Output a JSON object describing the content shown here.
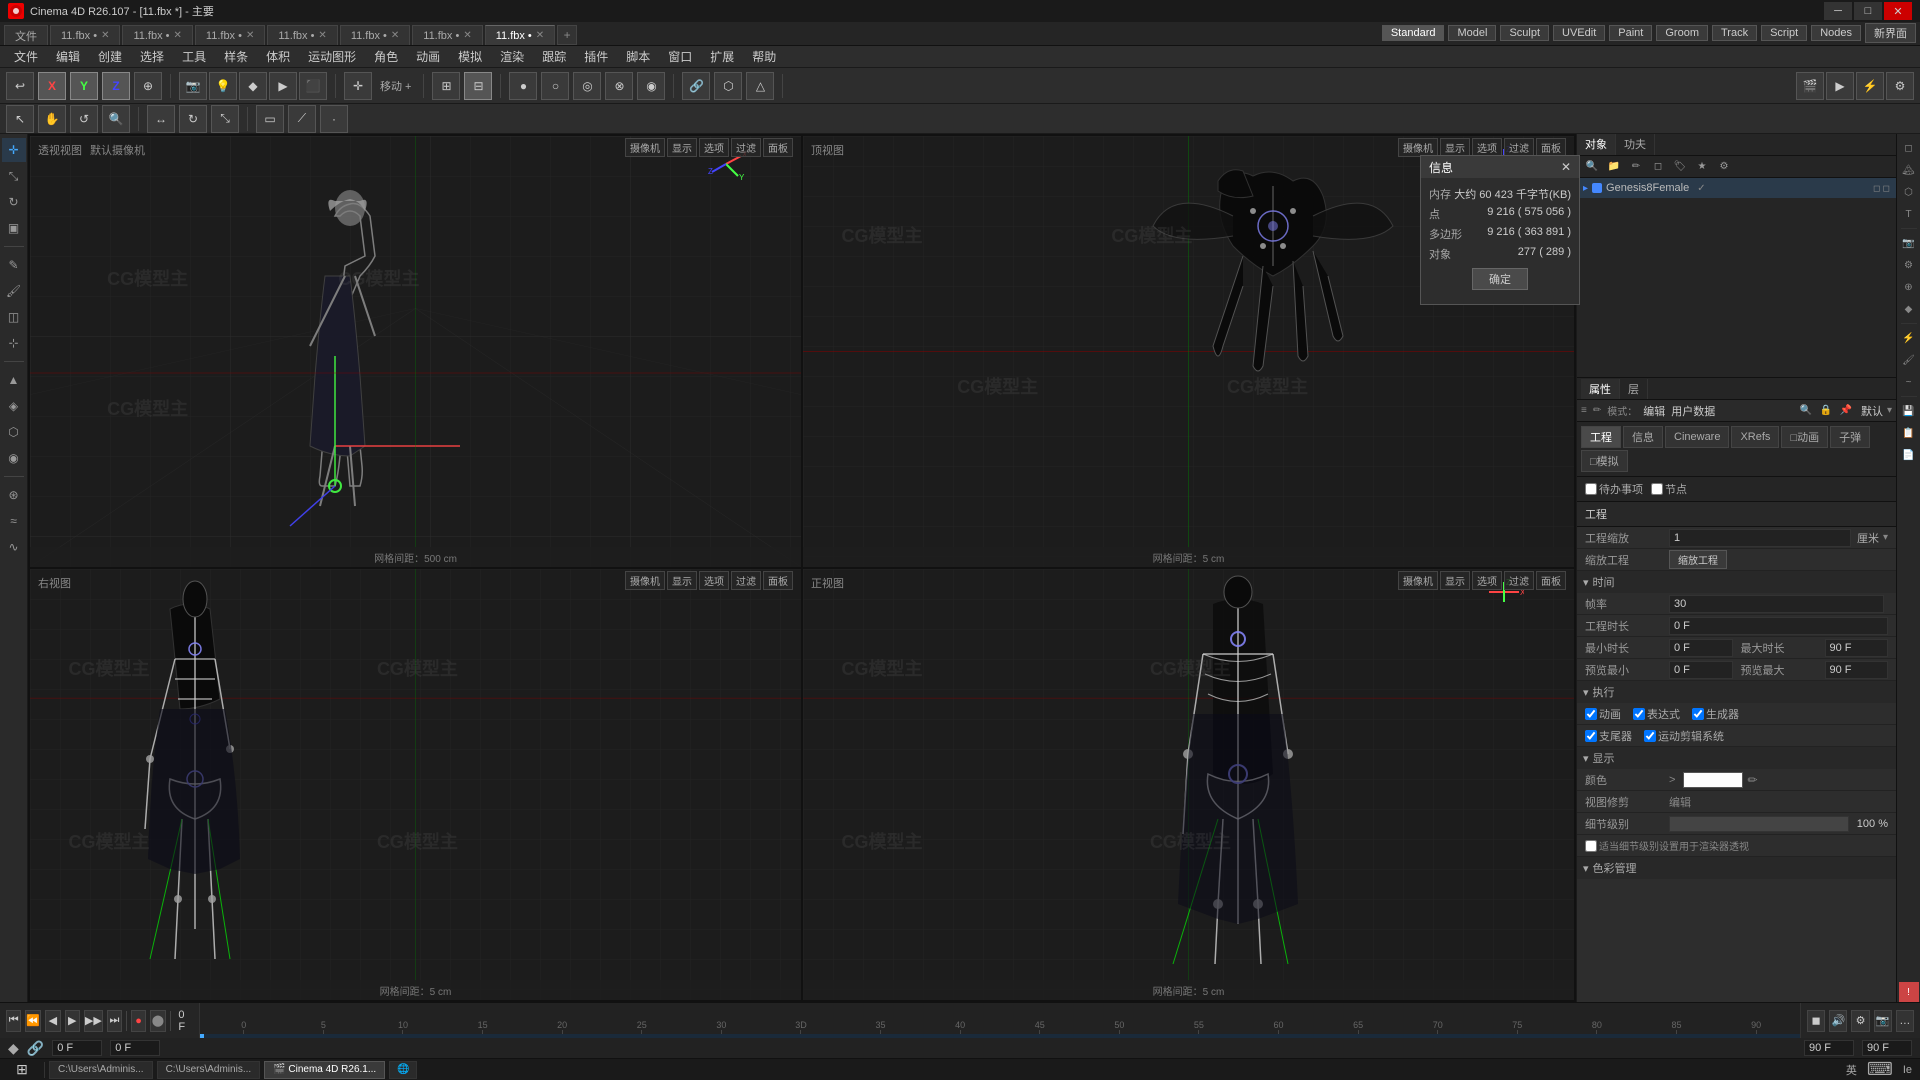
{
  "titlebar": {
    "title": "Cinema 4D R26.107 - [11.fbx *] - 主要",
    "close_label": "✕",
    "min_label": "─",
    "max_label": "□"
  },
  "tabs": [
    {
      "label": "文件",
      "active": false
    },
    {
      "label": "11.fbx •",
      "active": false
    },
    {
      "label": "11.fbx •",
      "active": false
    },
    {
      "label": "11.fbx •",
      "active": false
    },
    {
      "label": "11.fbx •",
      "active": false
    },
    {
      "label": "11.fbx •",
      "active": false
    },
    {
      "label": "11.fbx •",
      "active": false
    },
    {
      "label": "11.fbx •",
      "active": true
    },
    {
      "label": "+",
      "active": false
    }
  ],
  "tab_modes": [
    {
      "label": "Standard",
      "active": true
    },
    {
      "label": "Model",
      "active": false
    },
    {
      "label": "Sculpt",
      "active": false
    },
    {
      "label": "UVEdit",
      "active": false
    },
    {
      "label": "Paint",
      "active": false
    },
    {
      "label": "Groom",
      "active": false
    },
    {
      "label": "Track",
      "active": false
    },
    {
      "label": "Script",
      "active": false
    },
    {
      "label": "Nodes",
      "active": false
    },
    {
      "label": "新界面",
      "active": false
    }
  ],
  "menu": {
    "items": [
      "文件",
      "编辑",
      "创建",
      "选择",
      "工具",
      "样条",
      "体积",
      "运动图形",
      "角色",
      "动画",
      "模拟",
      "渲染",
      "跟踪",
      "插件",
      "脚本",
      "窗口",
      "扩展",
      "帮助"
    ]
  },
  "toolbar": {
    "axis_x": "X",
    "axis_y": "Y",
    "axis_z": "Z",
    "move_label": "移动 +"
  },
  "viewports": [
    {
      "label": "透视视图",
      "camera": "默认摄像机",
      "grid_info": "网格间距：500 cm",
      "position": "top-left"
    },
    {
      "label": "顶视图",
      "camera": "",
      "grid_info": "网格间距：5 cm",
      "position": "top-right"
    },
    {
      "label": "右视图",
      "camera": "",
      "grid_info": "网格间距：5 cm",
      "position": "bottom-left"
    },
    {
      "label": "正视图",
      "camera": "",
      "grid_info": "网格间距：5 cm",
      "position": "bottom-right"
    }
  ],
  "vp_menu_items": [
    "摄像机",
    "显示",
    "选项",
    "过滤",
    "面板"
  ],
  "info_dialog": {
    "title": "信息",
    "fields": [
      {
        "label": "内存",
        "value": "大约 60 423 千字节(KB)"
      },
      {
        "label": "点",
        "value": "9 216 ( 575 056 )"
      },
      {
        "label": "多边形",
        "value": "9 216 ( 363 891 )"
      },
      {
        "label": "对象",
        "value": "277 ( 289 )"
      }
    ],
    "confirm_btn": "确定"
  },
  "right_panel": {
    "tabs": [
      "对象",
      "功夫"
    ],
    "header_icons": [
      "搜索",
      "文件",
      "编辑",
      "对象",
      "标签",
      "书签",
      "设置"
    ],
    "object_tree": [
      {
        "name": "Genesis8Female",
        "color": "#4488ff",
        "selected": true,
        "indent": 0
      }
    ]
  },
  "properties": {
    "section_tabs": [
      "属性",
      "层"
    ],
    "prop_tabs": [
      "工程",
      "信息",
      "Cineware",
      "XRefs",
      "动画",
      "子弹",
      "模拟"
    ],
    "extra_tabs": [
      "待办事项",
      "节点"
    ],
    "section_label": "工程",
    "fields": [
      {
        "label": "工程缩放",
        "value": "1",
        "unit": "厘米"
      },
      {
        "label": "缩放工程",
        "value": ""
      },
      {
        "section": "时间",
        "type": "section"
      },
      {
        "label": "帧率",
        "value": "30"
      },
      {
        "label": "工程时长",
        "value": "0 F"
      },
      {
        "label": "最小时长",
        "value": "0 F"
      },
      {
        "label": "最大时长",
        "value": "90 F"
      },
      {
        "label": "预览最小",
        "value": "0 F"
      },
      {
        "label": "预览最大",
        "value": "90 F"
      },
      {
        "section": "执行",
        "type": "section"
      },
      {
        "label": "动画",
        "value": true,
        "type": "checkbox"
      },
      {
        "label": "表达式",
        "value": true,
        "type": "checkbox"
      },
      {
        "label": "生成器",
        "value": true,
        "type": "checkbox"
      },
      {
        "label": "支尾器",
        "value": true,
        "type": "checkbox"
      },
      {
        "label": "运动剪辑系统",
        "value": true,
        "type": "checkbox"
      },
      {
        "section": "显示",
        "type": "section"
      },
      {
        "label": "颜色",
        "value": "",
        "type": "color"
      },
      {
        "label": "视图修剪",
        "value": ""
      },
      {
        "label": "细节级别",
        "value": "100 %"
      },
      {
        "label": "适当细节级别设置用于渲染器透视",
        "value": false,
        "type": "checkbox"
      },
      {
        "section": "色彩管理",
        "type": "section"
      }
    ]
  },
  "timeline": {
    "control_buttons": [
      "⏮",
      "⏪",
      "⏴",
      "⏵",
      "⏩",
      "⏭",
      "⏺",
      "⏹"
    ],
    "frame_label": "0 F",
    "marks": [
      "0",
      "5",
      "10",
      "15",
      "20",
      "25",
      "30",
      "3D",
      "35",
      "40",
      "45",
      "50",
      "55",
      "60",
      "65",
      "70",
      "75",
      "80",
      "85",
      "90"
    ],
    "end_frame": "90 F",
    "end_frame2": "90 F"
  },
  "frame_bar": {
    "start": "0 F",
    "current": "0 F",
    "end1": "90 F",
    "end2": "90 F"
  },
  "taskbar": {
    "items": [
      "C:\\Users\\Adminis...",
      "C:\\Users\\Adminis...",
      "Cinema 4D R26.1...",
      "icon4"
    ],
    "time": "英"
  },
  "watermark": "CG模型主"
}
